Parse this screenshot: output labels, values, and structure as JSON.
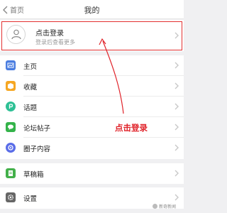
{
  "nav": {
    "back_label": "首页",
    "title": "我的"
  },
  "login": {
    "title": "点击登录",
    "subtitle": "登录后查看更多"
  },
  "menu": [
    {
      "label": "主页",
      "icon": "home-icon",
      "color": "#4a7de0"
    },
    {
      "label": "收藏",
      "icon": "box-icon",
      "color": "#f6a723"
    },
    {
      "label": "话题",
      "icon": "topic-icon",
      "color": "#2ec095"
    },
    {
      "label": "论坛帖子",
      "icon": "chat-icon",
      "color": "#34b34a"
    },
    {
      "label": "圈子内容",
      "icon": "circle-icon",
      "color": "#5a6de8"
    }
  ],
  "drafts": {
    "label": "草稿箱",
    "icon": "draft-icon",
    "color": "#43b04a"
  },
  "settings": {
    "label": "设置",
    "icon": "gear-icon",
    "color": "#666666"
  },
  "annotation": {
    "text": "点击登录",
    "color": "#e0232a"
  },
  "watermark": {
    "text": "新奇新闻"
  }
}
